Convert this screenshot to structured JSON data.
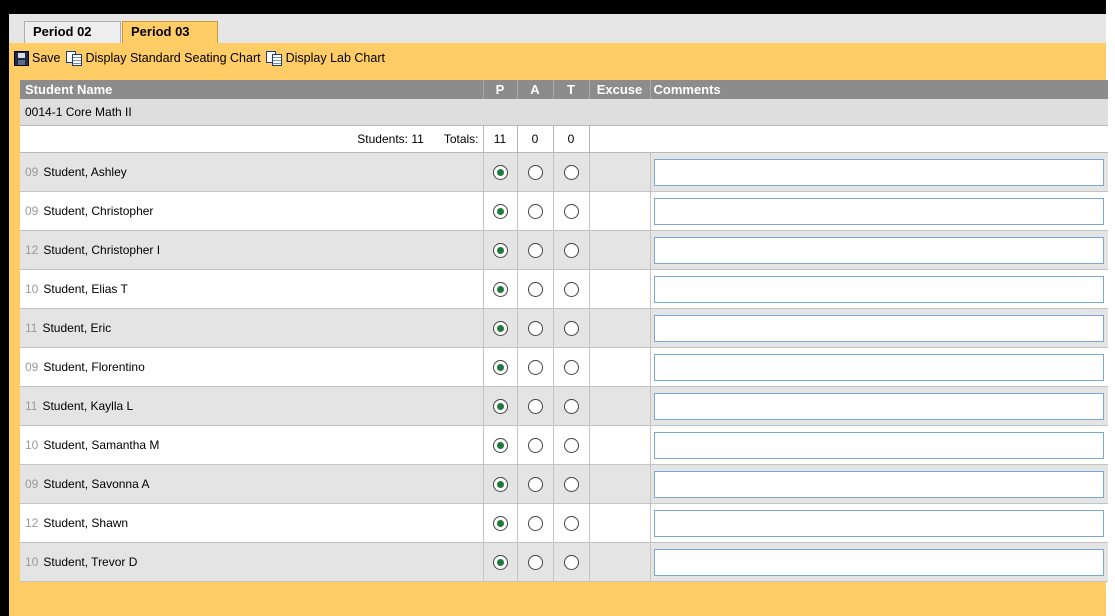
{
  "tabs": [
    {
      "label": "Period 02",
      "active": false
    },
    {
      "label": "Period 03",
      "active": true
    }
  ],
  "toolbar": {
    "save_label": "Save",
    "standard_chart_label": "Display Standard Seating Chart",
    "lab_chart_label": "Display Lab Chart"
  },
  "table": {
    "headers": {
      "student_name": "Student Name",
      "present": "P",
      "absent": "A",
      "tardy": "T",
      "excuse": "Excuse",
      "comments": "Comments"
    },
    "course": "0014-1 Core Math II",
    "summary": {
      "students_label": "Students:",
      "students_count": "11",
      "totals_label": "Totals:",
      "present_total": "11",
      "absent_total": "0",
      "tardy_total": "0"
    },
    "students": [
      {
        "grade": "09",
        "name": "Student, Ashley",
        "status": "P",
        "comment": ""
      },
      {
        "grade": "09",
        "name": "Student, Christopher",
        "status": "P",
        "comment": ""
      },
      {
        "grade": "12",
        "name": "Student, Christopher I",
        "status": "P",
        "comment": ""
      },
      {
        "grade": "10",
        "name": "Student, Elias T",
        "status": "P",
        "comment": ""
      },
      {
        "grade": "11",
        "name": "Student, Eric",
        "status": "P",
        "comment": ""
      },
      {
        "grade": "09",
        "name": "Student, Florentino",
        "status": "P",
        "comment": ""
      },
      {
        "grade": "11",
        "name": "Student, Kaylla L",
        "status": "P",
        "comment": ""
      },
      {
        "grade": "10",
        "name": "Student, Samantha M",
        "status": "P",
        "comment": ""
      },
      {
        "grade": "09",
        "name": "Student, Savonna A",
        "status": "P",
        "comment": ""
      },
      {
        "grade": "12",
        "name": "Student, Shawn",
        "status": "P",
        "comment": ""
      },
      {
        "grade": "10",
        "name": "Student, Trevor D",
        "status": "P",
        "comment": ""
      }
    ]
  },
  "colors": {
    "panel": "#ffcc66",
    "header": "#8c8c8c",
    "row_alt": "#e4e4e4",
    "radio_selected": "#1e7a3a"
  }
}
